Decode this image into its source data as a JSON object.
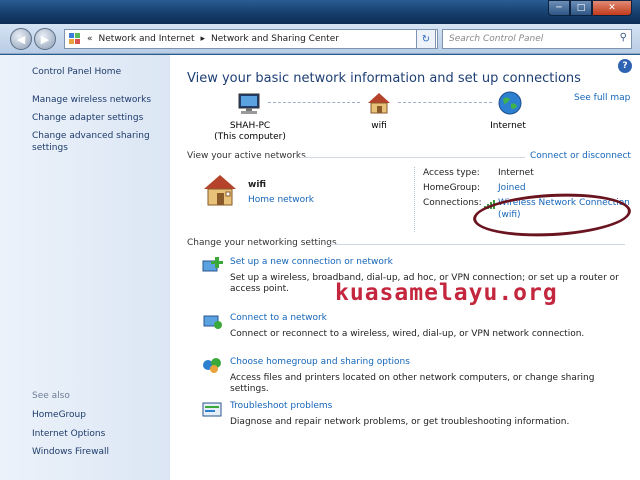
{
  "window": {
    "minimize": "─",
    "maximize": "□",
    "close": "✕"
  },
  "address": {
    "crumb_prefix": "«",
    "crumbs": [
      "Network and Internet",
      "Network and Sharing Center"
    ],
    "separator": "▸",
    "search_placeholder": "Search Control Panel"
  },
  "sidebar": {
    "items": [
      "Control Panel Home",
      "Manage wireless networks",
      "Change adapter settings",
      "Change advanced sharing settings"
    ],
    "see_also_title": "See also",
    "see_also": [
      "HomeGroup",
      "Internet Options",
      "Windows Firewall"
    ]
  },
  "main": {
    "heading": "View your basic network information and set up connections",
    "see_full_map": "See full map",
    "nodes": {
      "computer_name": "SHAH-PC",
      "computer_sub": "(This computer)",
      "network": "wifi",
      "internet": "Internet"
    },
    "active_title": "View your active networks",
    "connect_disconnect": "Connect or disconnect",
    "active_network": {
      "name": "wifi",
      "type": "Home network"
    },
    "details": {
      "access_label": "Access type:",
      "access_value": "Internet",
      "homegroup_label": "HomeGroup:",
      "homegroup_value": "Joined",
      "connections_label": "Connections:",
      "connection_value": "Wireless Network Connection",
      "connection_sub": "(wifi)"
    },
    "change_title": "Change your networking settings",
    "tasks": [
      {
        "title": "Set up a new connection or network",
        "desc": "Set up a wireless, broadband, dial-up, ad hoc, or VPN connection; or set up a router or access point."
      },
      {
        "title": "Connect to a network",
        "desc": "Connect or reconnect to a wireless, wired, dial-up, or VPN network connection."
      },
      {
        "title": "Choose homegroup and sharing options",
        "desc": "Access files and printers located on other network computers, or change sharing settings."
      },
      {
        "title": "Troubleshoot problems",
        "desc": "Diagnose and repair network problems, or get troubleshooting information."
      }
    ]
  },
  "watermark": "kuasamelayu.org",
  "colors": {
    "link": "#1565b8",
    "heading": "#1e3f74",
    "annotation": "#6a1420",
    "watermark": "#c4263e"
  }
}
